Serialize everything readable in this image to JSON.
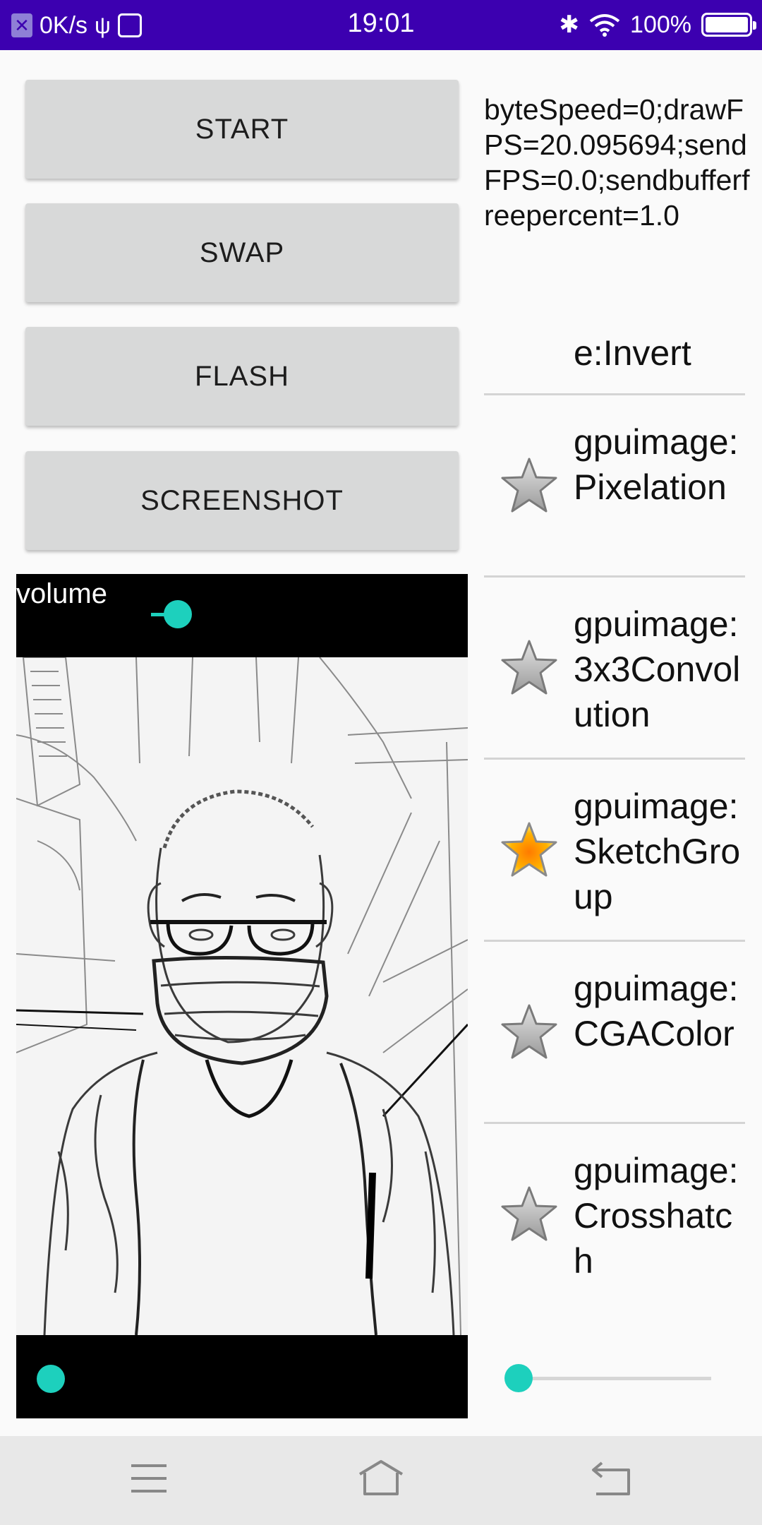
{
  "status_bar": {
    "net_speed": "0K/s",
    "time": "19:01",
    "battery": "100%",
    "icons": [
      "x-notification-icon",
      "usb-icon",
      "app-notification-icon",
      "bluetooth-icon",
      "wifi-icon",
      "battery-icon"
    ]
  },
  "buttons": {
    "start": "START",
    "swap": "SWAP",
    "flash": "FLASH",
    "screenshot": "SCREENSHOT"
  },
  "stats": {
    "text": "byteSpeed=0;drawFPS=20.095694;sendFPS=0.0;sendbufferfreepercent=1.0"
  },
  "filters": {
    "partial_label": "e:Invert",
    "items": [
      {
        "label": "gpuimage:Pixelation",
        "starred": false
      },
      {
        "label": "gpuimage:3x3Convolution",
        "starred": false
      },
      {
        "label": "gpuimage:SketchGroup",
        "starred": true
      },
      {
        "label": "gpuimage:CGAColor",
        "starred": false
      },
      {
        "label": "gpuimage:Crosshatch",
        "starred": false
      }
    ]
  },
  "camera": {
    "volume_label": "volume",
    "volume_level": 0.2,
    "bottom_slider_level": 0.0,
    "filter_slider_level": 0.0
  },
  "colors": {
    "status_bar": "#3c00b0",
    "accent": "#1dd0bd",
    "button_bg": "#d8d9d9",
    "star_active": "#ff9800"
  }
}
